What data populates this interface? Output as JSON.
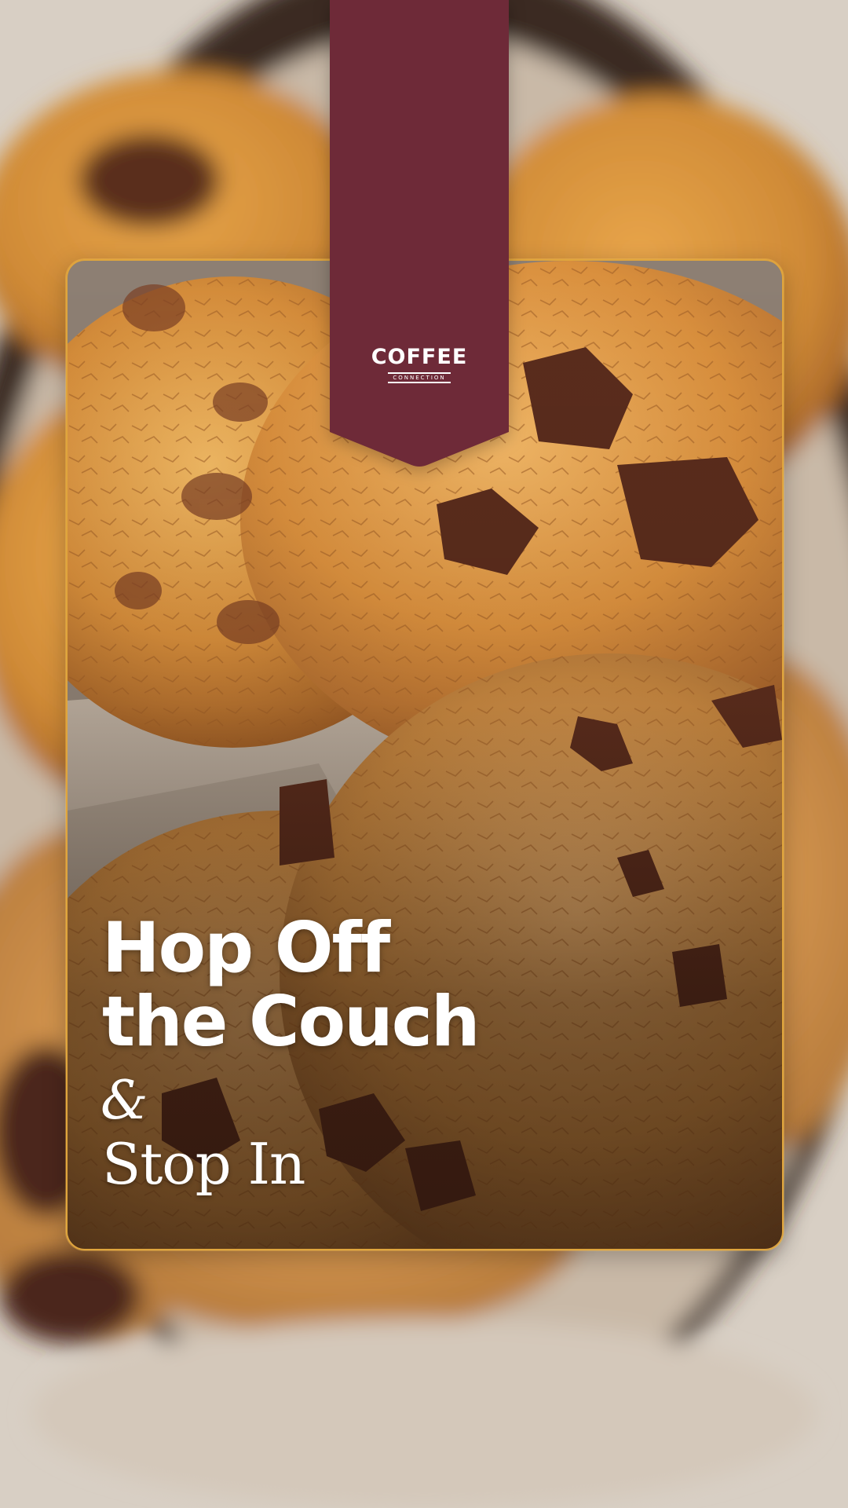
{
  "brand": {
    "name": "COFFEE",
    "tagline": "CONNECTION",
    "ribbon_color": "#6e2a38"
  },
  "headline": {
    "line1": "Hop Off",
    "line2": "the Couch",
    "ampersand": "&",
    "line3": "Stop In"
  },
  "colors": {
    "card_border": "#e0a53c",
    "text": "#ffffff"
  }
}
